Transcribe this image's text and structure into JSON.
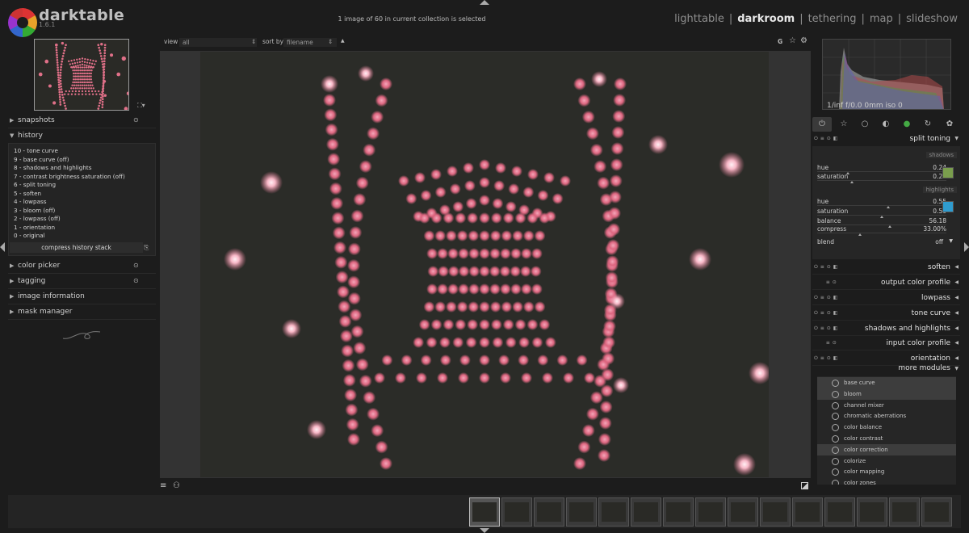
{
  "app": {
    "name": "darktable",
    "version": "1.6.1"
  },
  "status_text": "1 image of 60 in current collection is selected",
  "views": [
    "lighttable",
    "darkroom",
    "tethering",
    "map",
    "slideshow"
  ],
  "active_view": "darkroom",
  "toolbar": {
    "view_label": "view",
    "view_value": "all",
    "sort_label": "sort by",
    "sort_value": "filename",
    "sort_dir_icon": "▲",
    "right_icons": [
      "G",
      "☆",
      "⚙"
    ]
  },
  "left_panel": {
    "sections": {
      "snapshots": "snapshots",
      "history": "history",
      "color_picker": "color picker",
      "tagging": "tagging",
      "image_information": "image information",
      "mask_manager": "mask manager"
    },
    "history_items": [
      "10 - tone curve",
      "9 - base curve (off)",
      "8 - shadows and highlights",
      "7 - contrast brightness saturation (off)",
      "6 - split toning",
      "5 - soften",
      "4 - lowpass",
      "3 - bloom (off)",
      "2 - lowpass (off)",
      "1 - orientation",
      "0 - original"
    ],
    "compress_label": "compress history stack"
  },
  "right_panel": {
    "histogram_info": "1/inf f/0.0 0mm iso 0",
    "split_toning": {
      "title": "split toning",
      "shadows_label": "shadows",
      "highlights_label": "highlights",
      "shadows": [
        {
          "label": "hue",
          "value": "0.24",
          "frac": 0.24
        },
        {
          "label": "saturation",
          "value": "0.27",
          "frac": 0.27
        }
      ],
      "highlights": [
        {
          "label": "hue",
          "value": "0.55",
          "frac": 0.55
        },
        {
          "label": "saturation",
          "value": "0.50",
          "frac": 0.5
        }
      ],
      "balance": {
        "label": "balance",
        "value": "56.18",
        "frac": 0.5618
      },
      "compress": {
        "label": "compress",
        "value": "33.00%",
        "frac": 0.33
      },
      "blend_label": "blend",
      "blend_value": "off",
      "shadow_color": "#7a9e4d",
      "highlight_color": "#2f9ccf"
    },
    "modules": [
      "soften",
      "output color profile",
      "lowpass",
      "tone curve",
      "shadows and highlights",
      "input color profile",
      "orientation"
    ],
    "more_modules_label": "more modules",
    "more_modules": [
      {
        "name": "base curve",
        "hl": true
      },
      {
        "name": "bloom",
        "hl": true
      },
      {
        "name": "channel mixer",
        "hl": false
      },
      {
        "name": "chromatic aberrations",
        "hl": false
      },
      {
        "name": "color balance",
        "hl": false
      },
      {
        "name": "color contrast",
        "hl": false
      },
      {
        "name": "color correction",
        "hl": true
      },
      {
        "name": "colorize",
        "hl": false
      },
      {
        "name": "color mapping",
        "hl": false
      },
      {
        "name": "color zones",
        "hl": false
      }
    ]
  },
  "colors": {
    "accent_pink": "#d95a78",
    "background": "#1c1c1c"
  }
}
